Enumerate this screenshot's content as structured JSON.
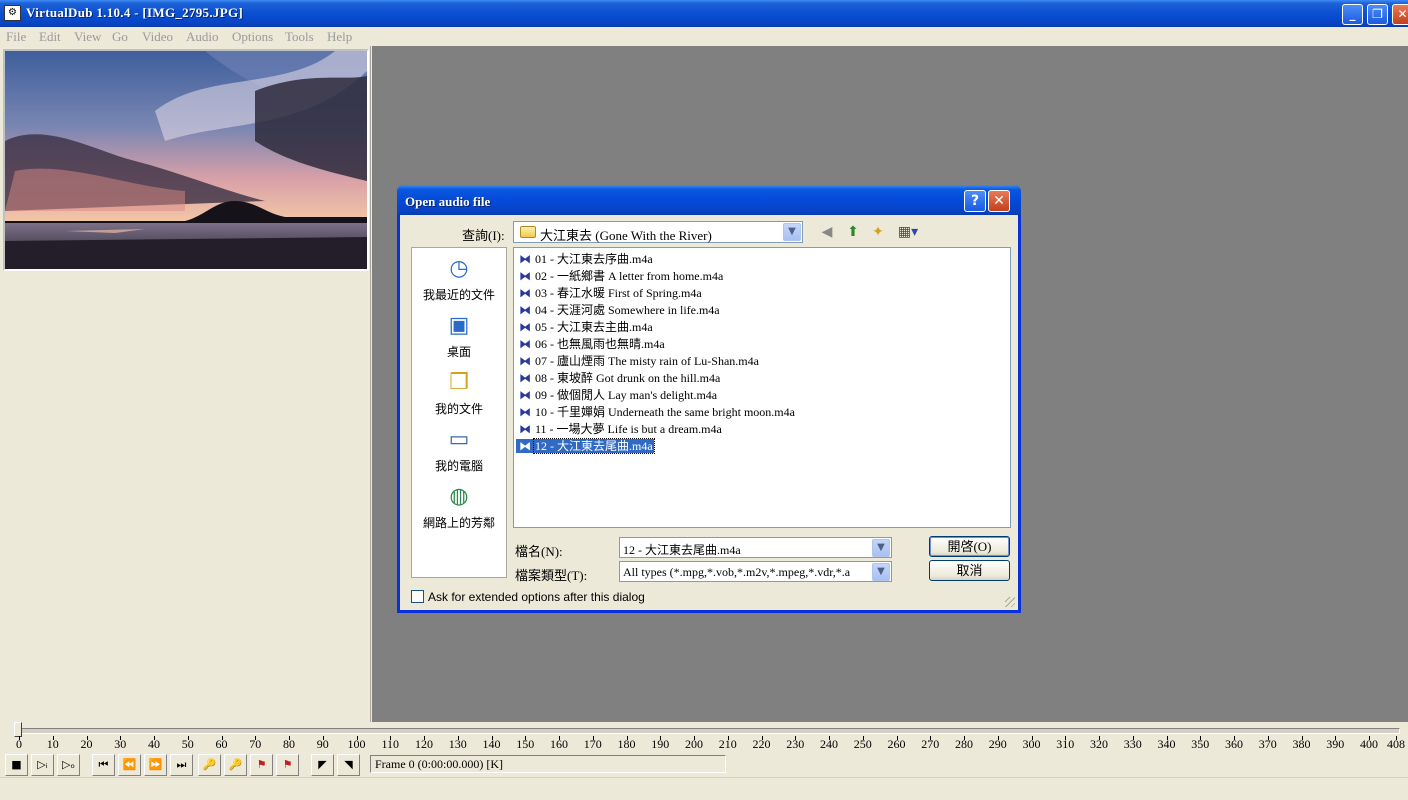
{
  "window": {
    "title": "VirtualDub 1.10.4 - [IMG_2795.JPG]",
    "icon": "vdub-app-icon",
    "controls": {
      "minimize": "_",
      "maximize": "❐",
      "close": "✕"
    }
  },
  "menu": [
    {
      "label": "File"
    },
    {
      "label": "Edit"
    },
    {
      "label": "View"
    },
    {
      "label": "Go"
    },
    {
      "label": "Video"
    },
    {
      "label": "Audio"
    },
    {
      "label": "Options"
    },
    {
      "label": "Tools"
    },
    {
      "label": "Help"
    }
  ],
  "timeline": {
    "ticks": [
      "0",
      "10",
      "20",
      "30",
      "40",
      "50",
      "60",
      "70",
      "80",
      "90",
      "100",
      "110",
      "120",
      "130",
      "140",
      "150",
      "160",
      "170",
      "180",
      "190",
      "200",
      "210",
      "220",
      "230",
      "240",
      "250",
      "260",
      "270",
      "280",
      "290",
      "300",
      "310",
      "320",
      "330",
      "340",
      "350",
      "360",
      "370",
      "380",
      "390",
      "400",
      "408"
    ],
    "frame_status": "Frame 0 (0:00:00.000) [K]",
    "position": 0
  },
  "dialog": {
    "title": "Open audio file",
    "help": "?",
    "close": "✕",
    "lookin_label": "查詢(I):",
    "lookin_value": "大江東去 (Gone With the River)",
    "places": [
      {
        "label": "我最近的文件",
        "icon": "recent-documents-icon"
      },
      {
        "label": "桌面",
        "icon": "desktop-icon"
      },
      {
        "label": "我的文件",
        "icon": "my-documents-icon"
      },
      {
        "label": "我的電腦",
        "icon": "my-computer-icon"
      },
      {
        "label": "網路上的芳鄰",
        "icon": "network-places-icon"
      }
    ],
    "files": [
      "01 - 大江東去序曲.m4a",
      "02 - 一紙鄉書 A letter from home.m4a",
      "03 - 春江水暖 First of Spring.m4a",
      "04 - 天涯河處 Somewhere in life.m4a",
      "05 - 大江東去主曲.m4a",
      "06 - 也無風雨也無晴.m4a",
      "07 - 廬山煙雨 The misty rain of Lu-Shan.m4a",
      "08 - 東坡醉 Got drunk on the hill.m4a",
      "09 - 做個閒人 Lay man's delight.m4a",
      "10 - 千里嬋娟 Underneath the same bright moon.m4a",
      "11 - 一場大夢 Life is but a dream.m4a",
      "12 - 大江東去尾曲.m4a"
    ],
    "selected_file_index": 11,
    "filename_label": "檔名(N):",
    "filename_value": "12 - 大江東去尾曲.m4a",
    "filetype_label": "檔案類型(T):",
    "filetype_value": "All types (*.mpg,*.vob,*.m2v,*.mpeg,*.vdr,*.a",
    "open_label": "開啓(O)",
    "cancel_label": "取消",
    "extended_label": "Ask for extended options after this dialog",
    "extended_checked": false
  },
  "colors": {
    "titlebar": "#0a4fd2",
    "workspace": "#808080",
    "face": "#ece9d8",
    "selection": "#316ac5"
  }
}
